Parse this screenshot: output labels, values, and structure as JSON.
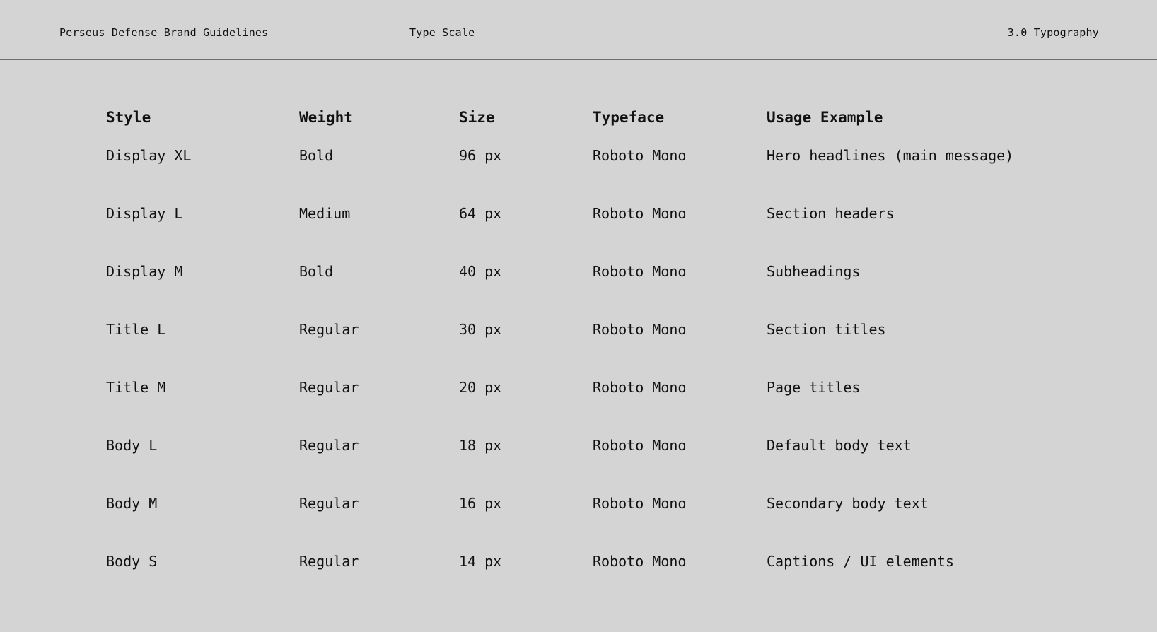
{
  "header": {
    "brand": "Perseus Defense Brand Guidelines",
    "section": "Type Scale",
    "chapter": "3.0 Typography"
  },
  "table": {
    "columns": [
      "Style",
      "Weight",
      "Size",
      "Typeface",
      "Usage Example"
    ],
    "rows": [
      {
        "style": "Display XL",
        "weight": "Bold",
        "size": "96 px",
        "typeface": "Roboto Mono",
        "usage": "Hero headlines (main message)"
      },
      {
        "style": "Display L",
        "weight": "Medium",
        "size": "64 px",
        "typeface": "Roboto Mono",
        "usage": "Section headers"
      },
      {
        "style": "Display M",
        "weight": "Bold",
        "size": "40 px",
        "typeface": "Roboto Mono",
        "usage": "Subheadings"
      },
      {
        "style": "Title L",
        "weight": "Regular",
        "size": "30 px",
        "typeface": "Roboto Mono",
        "usage": "Section titles"
      },
      {
        "style": "Title M",
        "weight": "Regular",
        "size": "20 px",
        "typeface": "Roboto Mono",
        "usage": "Page titles"
      },
      {
        "style": "Body L",
        "weight": "Regular",
        "size": "18 px",
        "typeface": "Roboto Mono",
        "usage": "Default body text"
      },
      {
        "style": "Body M",
        "weight": "Regular",
        "size": "16 px",
        "typeface": "Roboto Mono",
        "usage": "Secondary body text"
      },
      {
        "style": "Body S",
        "weight": "Regular",
        "size": "14 px",
        "typeface": "Roboto Mono",
        "usage": "Captions / UI elements"
      }
    ]
  },
  "colors": {
    "background": "#d4d4d4",
    "text": "#111111",
    "rule": "#6e6e6e"
  }
}
